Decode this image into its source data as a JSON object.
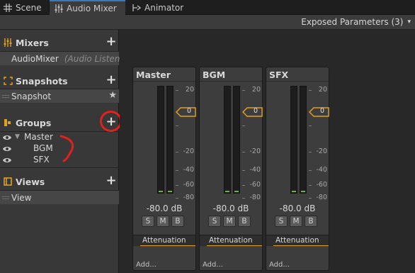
{
  "tabs": [
    {
      "label": "Scene",
      "icon": "grid-icon",
      "active": false
    },
    {
      "label": "Audio Mixer",
      "icon": "mixer-icon",
      "active": true
    },
    {
      "label": "Animator",
      "icon": "animator-icon",
      "active": false
    }
  ],
  "toolbar": {
    "exposed_label": "Exposed Parameters (3)",
    "caret": "▾"
  },
  "sidebar": {
    "mixers": {
      "title": "Mixers",
      "plus": "+",
      "items": [
        {
          "name": "AudioMixer",
          "sub": "(Audio Listene"
        }
      ]
    },
    "snapshots": {
      "title": "Snapshots",
      "plus": "+",
      "items": [
        {
          "name": "Snapshot",
          "star": "★"
        }
      ]
    },
    "groups": {
      "title": "Groups",
      "plus": "+",
      "items": [
        {
          "name": "Master",
          "expanded": "▼"
        },
        {
          "name": "BGM"
        },
        {
          "name": "SFX"
        }
      ]
    },
    "views": {
      "title": "Views",
      "plus": "+",
      "items": [
        {
          "name": "View"
        }
      ]
    }
  },
  "scale_labels": [
    "20",
    "0",
    "-20",
    "-40",
    "-60",
    "-80"
  ],
  "strips": [
    {
      "name": "Master",
      "db": "-80.0 dB",
      "volume": "0",
      "s": "S",
      "m": "M",
      "b": "B",
      "effect": "Attenuation",
      "add": "Add..."
    },
    {
      "name": "BGM",
      "db": "-80.0 dB",
      "volume": "0",
      "s": "S",
      "m": "M",
      "b": "B",
      "effect": "Attenuation",
      "add": "Add..."
    },
    {
      "name": "SFX",
      "db": "-80.0 dB",
      "volume": "0",
      "s": "S",
      "m": "M",
      "b": "B",
      "effect": "Attenuation",
      "add": "Add..."
    }
  ],
  "colors": {
    "accent": "#e0a020",
    "meter_green": "#6fb33a",
    "annotation_red": "#e0211c",
    "tab_highlight": "#3a79bb"
  }
}
